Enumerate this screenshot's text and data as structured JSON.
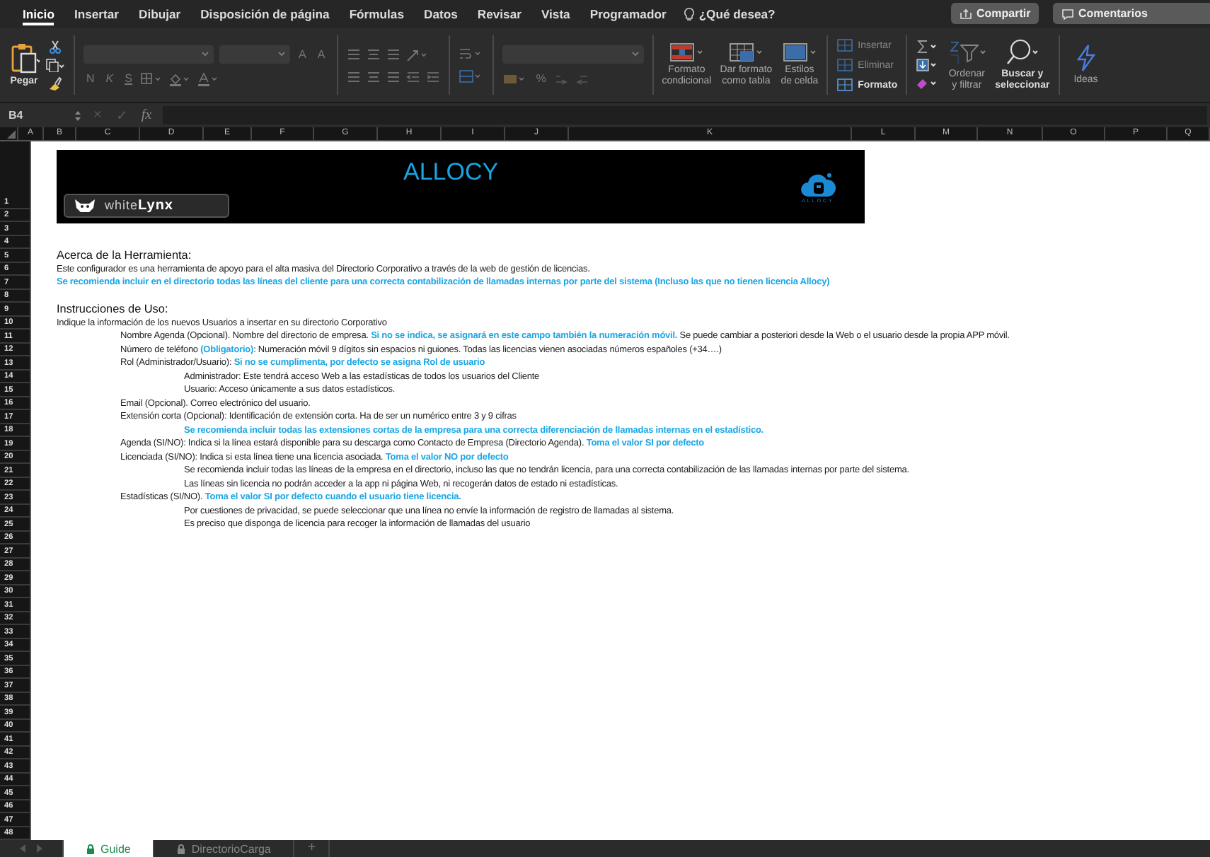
{
  "ribbon": {
    "tabs": [
      {
        "label": "Inicio",
        "selected": true
      },
      {
        "label": "Insertar",
        "selected": false
      },
      {
        "label": "Dibujar",
        "selected": false
      },
      {
        "label": "Disposición de página",
        "selected": false
      },
      {
        "label": "Fórmulas",
        "selected": false
      },
      {
        "label": "Datos",
        "selected": false
      },
      {
        "label": "Revisar",
        "selected": false
      },
      {
        "label": "Vista",
        "selected": false
      },
      {
        "label": "Programador",
        "selected": false
      }
    ],
    "search": "¿Qué desea?",
    "share": "Compartir",
    "comments": "Comentarios"
  },
  "toolbar": {
    "paste": "Pegar",
    "font_size_buttons": [
      "A",
      "A"
    ],
    "format_letters": [
      "N",
      "K",
      "S"
    ],
    "percent": "%",
    "styles": [
      "Formato\ncondicional",
      "Dar formato\ncomo tabla",
      "Estilos\nde celda"
    ],
    "cells": [
      {
        "label": "Insertar",
        "disabled": true
      },
      {
        "label": "Eliminar",
        "disabled": true
      },
      {
        "label": "Formato",
        "disabled": false
      }
    ],
    "sort": {
      "label": "Ordenar\ny filtrar",
      "disabled": true
    },
    "find": {
      "label": "Buscar y\nseleccionar",
      "disabled": false
    },
    "ideas": "Ideas"
  },
  "formula_bar": {
    "name_box": "B4",
    "cancel": "×",
    "enter": "✓",
    "fx": "fx"
  },
  "columns": [
    "A",
    "B",
    "C",
    "D",
    "E",
    "F",
    "G",
    "H",
    "I",
    "J",
    "K",
    "L",
    "M",
    "N",
    "O",
    "P",
    "Q"
  ],
  "row_numbers": [
    "1",
    "2",
    "3",
    "4",
    "5",
    "6",
    "7",
    "8",
    "9",
    "10",
    "11",
    "12",
    "13",
    "14",
    "15",
    "16",
    "17",
    "18",
    "19",
    "20",
    "21",
    "22",
    "23",
    "24",
    "25",
    "26",
    "27",
    "28",
    "29",
    "30",
    "31",
    "32",
    "33",
    "34",
    "35",
    "36",
    "37",
    "38",
    "39",
    "40",
    "41",
    "42",
    "43",
    "44",
    "45",
    "46",
    "47",
    "48"
  ],
  "banner": {
    "brand": "white**Lynx**",
    "title": "ALLOCY",
    "logo_caption": "ALLOCY"
  },
  "about": {
    "heading": "Acerca de la Herramienta:",
    "lines": [
      {
        "kind": "text",
        "text": "Este configurador es una herramienta de apoyo para el alta masiva del Directorio Corporativo a través de la web de gestión de licencias."
      },
      {
        "kind": "note",
        "text": "Se recomienda incluir en el directorio todas las líneas del cliente para una correcta contabilización de llamadas internas por parte del sistema (Incluso las que no tienen licencia Allocy)"
      }
    ]
  },
  "instructions": {
    "heading": "Instrucciones de Uso:",
    "intro": "Indique la información de los nuevos Usuarios a insertar en su directorio Corporativo",
    "items": [
      {
        "kind": "text",
        "text": "Nombre Agenda (Opcional). Nombre del directorio de empresa. **Si no se indica, se asignará en este campo también la numeración móvil.** Se puede cambiar a posteriori desde la Web o el usuario desde la propia APP móvil."
      },
      {
        "kind": "text",
        "text": "Número de teléfono **(Obligatorio)**: Numeración móvil 9 dígitos sin espacios ni guiones. Todas las licencias vienen asociadas números españoles (+34….)"
      },
      {
        "kind": "text",
        "text": "Rol (Administrador/Usuario): **Si no se cumplimenta, por defecto se asigna Rol de usuario**",
        "children": [
          {
            "kind": "text",
            "text": "Administrador: Este tendrá acceso Web a las estadísticas de todos los usuarios del Cliente"
          },
          {
            "kind": "text",
            "text": "Usuario: Acceso únicamente a sus datos estadísticos."
          }
        ]
      },
      {
        "kind": "text",
        "text": "Email (Opcional). Correo electrónico del usuario."
      },
      {
        "kind": "text",
        "text": "Extensión corta (Opcional): Identificación de extensión corta. Ha de ser un numérico entre 3 y 9 cifras",
        "children": [
          {
            "kind": "note",
            "text": "Se recomienda incluir todas las extensiones cortas de la empresa para una correcta diferenciación de llamadas internas en el estadístico."
          }
        ]
      },
      {
        "kind": "text",
        "text": "Agenda (SI/NO): Indica si la línea estará disponible para su descarga como Contacto de Empresa (Directorio Agenda). **Toma el valor SI por defecto**"
      },
      {
        "kind": "text",
        "text": "Licenciada (SI/NO): Indica si esta línea tiene una licencia asociada. **Toma el valor NO por defecto**",
        "children": [
          {
            "kind": "text",
            "text": "Se recomienda incluir todas las líneas de la empresa en el directorio, incluso las que no tendrán licencia, para una correcta contabilización de las llamadas internas por parte del sistema."
          },
          {
            "kind": "text",
            "text": "Las líneas sin licencia no podrán acceder a la app ni página Web, ni recogerán datos de estado ni estadísticas."
          }
        ]
      },
      {
        "kind": "text",
        "text": "Estadísticas (SI/NO).  **Toma el valor SI por defecto cuando el usuario tiene licencia.**",
        "children": [
          {
            "kind": "text",
            "text": "Por cuestiones de privacidad, se puede seleccionar que una línea no envíe la información de registro de llamadas al sistema."
          },
          {
            "kind": "text",
            "text": "Es preciso que disponga de licencia para recoger la información de llamadas del usuario"
          }
        ]
      }
    ]
  },
  "sheet_tabs": [
    {
      "label": "Guide",
      "selected": true,
      "locked": true
    },
    {
      "label": "DirectorioCarga",
      "selected": false,
      "locked": true
    }
  ],
  "add_sheet": "+"
}
